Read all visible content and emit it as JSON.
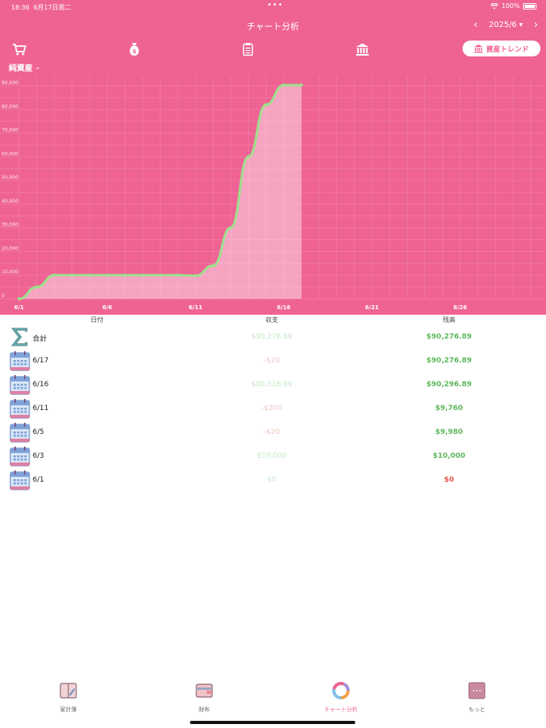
{
  "status_bar": {
    "time": "18:36",
    "date": "6月17日周二",
    "battery": "100%"
  },
  "header": {
    "title": "チャート分析",
    "month": "2025/6",
    "prev_icon": "chevron-left-icon",
    "next_icon": "chevron-right-icon"
  },
  "category_icons": [
    "cart-icon",
    "money-bag-icon",
    "clipboard-icon",
    "bank-icon"
  ],
  "trend_button": {
    "label": "資産トレンド",
    "icon": "bank-icon"
  },
  "selector": {
    "label": "純資産"
  },
  "colors": {
    "header_bg": "#ef6394",
    "line": "#9ee08c",
    "income": "#5cb85c",
    "zero": "#e8554e"
  },
  "chart_data": {
    "type": "area",
    "x": [
      "6/1",
      "6/2",
      "6/3",
      "6/4",
      "6/5",
      "6/6",
      "6/7",
      "6/8",
      "6/9",
      "6/10",
      "6/11",
      "6/12",
      "6/13",
      "6/14",
      "6/15",
      "6/16",
      "6/17"
    ],
    "values": [
      0,
      5000,
      10000,
      10000,
      9980,
      9980,
      9980,
      9980,
      9980,
      9980,
      9760,
      14000,
      30000,
      60000,
      82000,
      90296.89,
      90276.89
    ],
    "x_ticks": [
      "6/1",
      "6/6",
      "6/11",
      "6/16",
      "6/21",
      "6/26"
    ],
    "y_ticks": [
      "0",
      "10,000",
      "20,000",
      "30,000",
      "40,000",
      "50,000",
      "60,000",
      "70,000",
      "80,000",
      "90,000"
    ],
    "ylim": [
      0,
      90000
    ],
    "grid": true
  },
  "table": {
    "headers": {
      "date": "日付",
      "flow": "収支",
      "balance": "残高"
    },
    "total": {
      "label": "合計",
      "flow": "$90,276.89",
      "balance": "$90,276.89"
    },
    "rows": [
      {
        "date": "6/17",
        "flow": "-$20",
        "balance": "$90,276.89"
      },
      {
        "date": "6/16",
        "flow": "$80,516.89",
        "balance": "$90,296.89"
      },
      {
        "date": "6/11",
        "flow": "-$200",
        "balance": "$9,760"
      },
      {
        "date": "6/5",
        "flow": "-$20",
        "balance": "$9,980"
      },
      {
        "date": "6/3",
        "flow": "$10,000",
        "balance": "$10,000"
      },
      {
        "date": "6/1",
        "flow": "$0",
        "balance": "$0"
      }
    ]
  },
  "tabs": [
    {
      "label": "家計簿",
      "icon": "book-icon"
    },
    {
      "label": "財布",
      "icon": "wallet-icon"
    },
    {
      "label": "チャート分析",
      "icon": "pie-chart-icon",
      "active": true
    },
    {
      "label": "もっと",
      "icon": "more-icon"
    }
  ]
}
